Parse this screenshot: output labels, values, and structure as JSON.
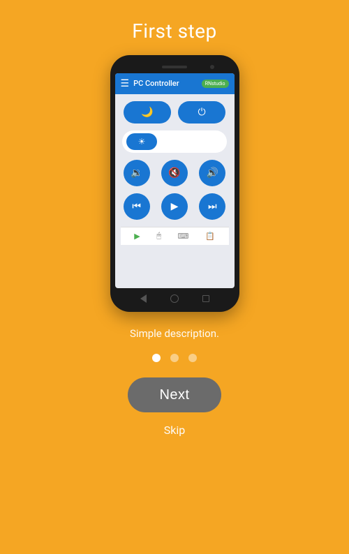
{
  "page": {
    "title": "First step",
    "description": "Simple description.",
    "background_color": "#F5A623"
  },
  "app_bar": {
    "title": "PC Controller",
    "badge_label": "RNstudio",
    "menu_icon": "☰"
  },
  "phone_bottom_icons": [
    {
      "icon": "▶",
      "color": "green"
    },
    {
      "icon": "🖱",
      "color": "gray"
    },
    {
      "icon": "⌨",
      "color": "gray"
    },
    {
      "icon": "📋",
      "color": "gray"
    }
  ],
  "nav_items": [
    {
      "type": "triangle"
    },
    {
      "type": "circle"
    },
    {
      "type": "square"
    }
  ],
  "dots": [
    {
      "active": true
    },
    {
      "active": false
    },
    {
      "active": false
    }
  ],
  "next_button": {
    "label": "Next"
  },
  "skip_button": {
    "label": "Skip"
  },
  "icons": {
    "moon": "🌙",
    "power": "⏻",
    "brightness": "☀",
    "vol_down": "🔉",
    "mute": "🔇",
    "vol_up": "🔊",
    "rewind": "⏮",
    "play": "▶",
    "fast_forward": "⏭"
  }
}
